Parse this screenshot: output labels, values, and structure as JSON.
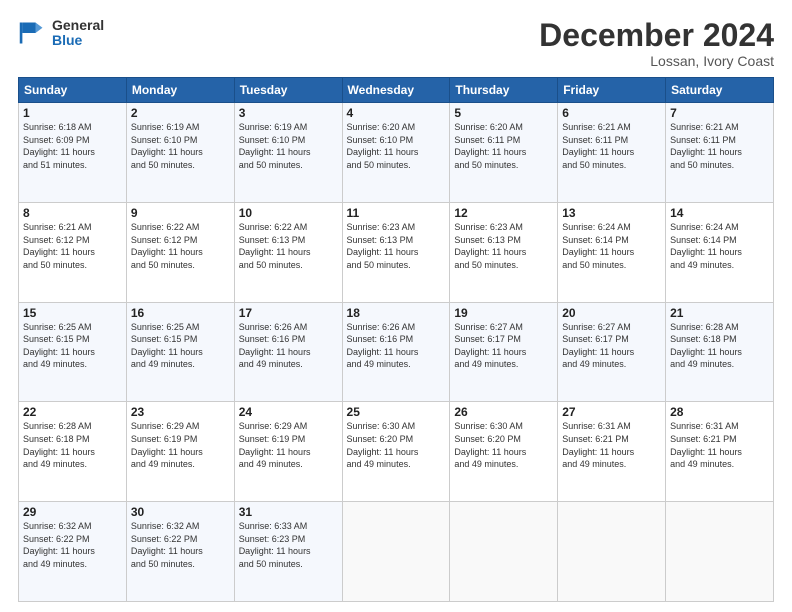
{
  "logo": {
    "line1": "General",
    "line2": "Blue"
  },
  "title": "December 2024",
  "subtitle": "Lossan, Ivory Coast",
  "days_header": [
    "Sunday",
    "Monday",
    "Tuesday",
    "Wednesday",
    "Thursday",
    "Friday",
    "Saturday"
  ],
  "weeks": [
    [
      {
        "day": "1",
        "info": "Sunrise: 6:18 AM\nSunset: 6:09 PM\nDaylight: 11 hours\nand 51 minutes."
      },
      {
        "day": "2",
        "info": "Sunrise: 6:19 AM\nSunset: 6:10 PM\nDaylight: 11 hours\nand 50 minutes."
      },
      {
        "day": "3",
        "info": "Sunrise: 6:19 AM\nSunset: 6:10 PM\nDaylight: 11 hours\nand 50 minutes."
      },
      {
        "day": "4",
        "info": "Sunrise: 6:20 AM\nSunset: 6:10 PM\nDaylight: 11 hours\nand 50 minutes."
      },
      {
        "day": "5",
        "info": "Sunrise: 6:20 AM\nSunset: 6:11 PM\nDaylight: 11 hours\nand 50 minutes."
      },
      {
        "day": "6",
        "info": "Sunrise: 6:21 AM\nSunset: 6:11 PM\nDaylight: 11 hours\nand 50 minutes."
      },
      {
        "day": "7",
        "info": "Sunrise: 6:21 AM\nSunset: 6:11 PM\nDaylight: 11 hours\nand 50 minutes."
      }
    ],
    [
      {
        "day": "8",
        "info": "Sunrise: 6:21 AM\nSunset: 6:12 PM\nDaylight: 11 hours\nand 50 minutes."
      },
      {
        "day": "9",
        "info": "Sunrise: 6:22 AM\nSunset: 6:12 PM\nDaylight: 11 hours\nand 50 minutes."
      },
      {
        "day": "10",
        "info": "Sunrise: 6:22 AM\nSunset: 6:13 PM\nDaylight: 11 hours\nand 50 minutes."
      },
      {
        "day": "11",
        "info": "Sunrise: 6:23 AM\nSunset: 6:13 PM\nDaylight: 11 hours\nand 50 minutes."
      },
      {
        "day": "12",
        "info": "Sunrise: 6:23 AM\nSunset: 6:13 PM\nDaylight: 11 hours\nand 50 minutes."
      },
      {
        "day": "13",
        "info": "Sunrise: 6:24 AM\nSunset: 6:14 PM\nDaylight: 11 hours\nand 50 minutes."
      },
      {
        "day": "14",
        "info": "Sunrise: 6:24 AM\nSunset: 6:14 PM\nDaylight: 11 hours\nand 49 minutes."
      }
    ],
    [
      {
        "day": "15",
        "info": "Sunrise: 6:25 AM\nSunset: 6:15 PM\nDaylight: 11 hours\nand 49 minutes."
      },
      {
        "day": "16",
        "info": "Sunrise: 6:25 AM\nSunset: 6:15 PM\nDaylight: 11 hours\nand 49 minutes."
      },
      {
        "day": "17",
        "info": "Sunrise: 6:26 AM\nSunset: 6:16 PM\nDaylight: 11 hours\nand 49 minutes."
      },
      {
        "day": "18",
        "info": "Sunrise: 6:26 AM\nSunset: 6:16 PM\nDaylight: 11 hours\nand 49 minutes."
      },
      {
        "day": "19",
        "info": "Sunrise: 6:27 AM\nSunset: 6:17 PM\nDaylight: 11 hours\nand 49 minutes."
      },
      {
        "day": "20",
        "info": "Sunrise: 6:27 AM\nSunset: 6:17 PM\nDaylight: 11 hours\nand 49 minutes."
      },
      {
        "day": "21",
        "info": "Sunrise: 6:28 AM\nSunset: 6:18 PM\nDaylight: 11 hours\nand 49 minutes."
      }
    ],
    [
      {
        "day": "22",
        "info": "Sunrise: 6:28 AM\nSunset: 6:18 PM\nDaylight: 11 hours\nand 49 minutes."
      },
      {
        "day": "23",
        "info": "Sunrise: 6:29 AM\nSunset: 6:19 PM\nDaylight: 11 hours\nand 49 minutes."
      },
      {
        "day": "24",
        "info": "Sunrise: 6:29 AM\nSunset: 6:19 PM\nDaylight: 11 hours\nand 49 minutes."
      },
      {
        "day": "25",
        "info": "Sunrise: 6:30 AM\nSunset: 6:20 PM\nDaylight: 11 hours\nand 49 minutes."
      },
      {
        "day": "26",
        "info": "Sunrise: 6:30 AM\nSunset: 6:20 PM\nDaylight: 11 hours\nand 49 minutes."
      },
      {
        "day": "27",
        "info": "Sunrise: 6:31 AM\nSunset: 6:21 PM\nDaylight: 11 hours\nand 49 minutes."
      },
      {
        "day": "28",
        "info": "Sunrise: 6:31 AM\nSunset: 6:21 PM\nDaylight: 11 hours\nand 49 minutes."
      }
    ],
    [
      {
        "day": "29",
        "info": "Sunrise: 6:32 AM\nSunset: 6:22 PM\nDaylight: 11 hours\nand 49 minutes."
      },
      {
        "day": "30",
        "info": "Sunrise: 6:32 AM\nSunset: 6:22 PM\nDaylight: 11 hours\nand 50 minutes."
      },
      {
        "day": "31",
        "info": "Sunrise: 6:33 AM\nSunset: 6:23 PM\nDaylight: 11 hours\nand 50 minutes."
      },
      {
        "day": "",
        "info": ""
      },
      {
        "day": "",
        "info": ""
      },
      {
        "day": "",
        "info": ""
      },
      {
        "day": "",
        "info": ""
      }
    ]
  ]
}
